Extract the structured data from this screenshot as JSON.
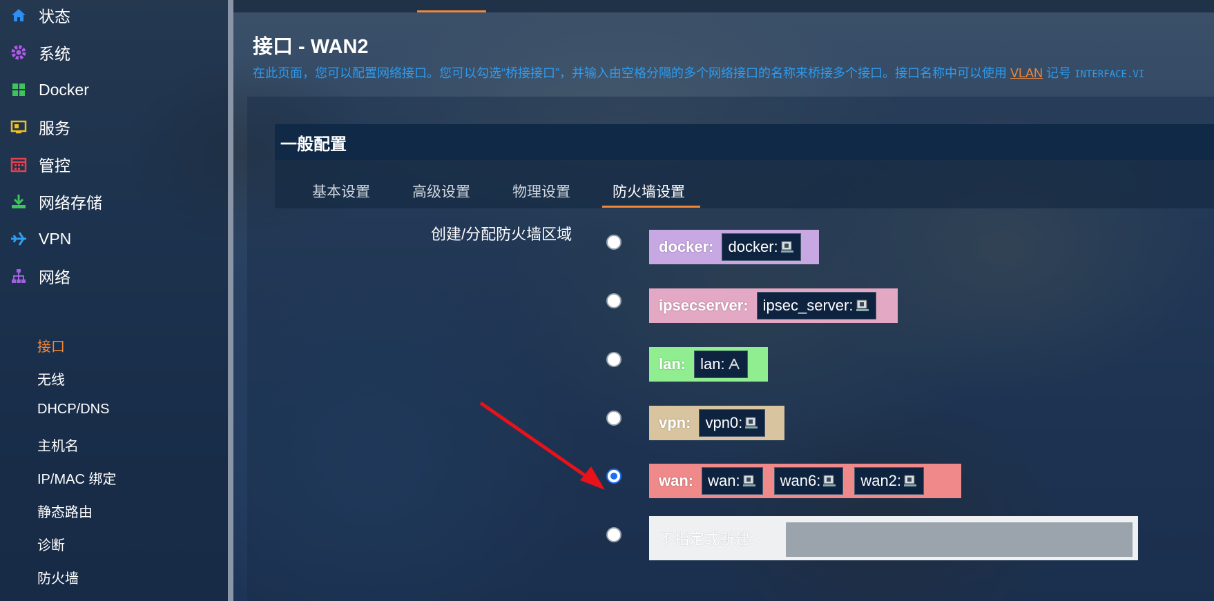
{
  "sidebar": {
    "items": [
      {
        "label": "状态",
        "icon": "home-icon"
      },
      {
        "label": "系统",
        "icon": "gear-icon"
      },
      {
        "label": "Docker",
        "icon": "docker-icon"
      },
      {
        "label": "服务",
        "icon": "services-icon"
      },
      {
        "label": "管控",
        "icon": "calendar-icon"
      },
      {
        "label": "网络存储",
        "icon": "download-icon"
      },
      {
        "label": "VPN",
        "icon": "plane-icon"
      },
      {
        "label": "网络",
        "icon": "network-icon"
      }
    ],
    "sub_items": [
      "接口",
      "无线",
      "DHCP/DNS",
      "主机名",
      "IP/MAC 绑定",
      "静态路由",
      "诊断",
      "防火墙"
    ],
    "active_sub": "接口"
  },
  "page": {
    "title": "接口 - WAN2",
    "description_prefix": "在此页面，您可以配置网络接口。您可以勾选“桥接接口”，并输入由空格分隔的多个网络接口的名称来桥接多个接口。接口名称中可以使用",
    "description_link": "VLAN",
    "description_suffix": "记号",
    "description_code": "INTERFACE.VI"
  },
  "section": {
    "title": "一般配置",
    "tabs": [
      "基本设置",
      "高级设置",
      "物理设置",
      "防火墙设置"
    ],
    "active_tab": "防火墙设置"
  },
  "firewall": {
    "field_label": "创建/分配防火墙区域",
    "zones": [
      {
        "name": "docker:",
        "color": "#c7a8e2",
        "networks": [
          "docker:"
        ],
        "checked": false
      },
      {
        "name": "ipsecserver:",
        "color": "#e3a8c4",
        "networks": [
          "ipsec_server:"
        ],
        "checked": false
      },
      {
        "name": "lan:",
        "color": "#90ee90",
        "networks": [
          "lan:"
        ],
        "checked": false
      },
      {
        "name": "vpn:",
        "color": "#d9c4a0",
        "networks": [
          "vpn0:"
        ],
        "checked": false
      },
      {
        "name": "wan:",
        "color": "#f08a8a",
        "networks": [
          "wan:",
          "wan6:",
          "wan2:"
        ],
        "checked": true
      }
    ],
    "new_zone_label": "不指定或新建:",
    "new_zone_value": ""
  },
  "colors": {
    "accent": "#f0883a",
    "link_blue": "#2c9cf0",
    "arrow_red": "#e8121a"
  }
}
